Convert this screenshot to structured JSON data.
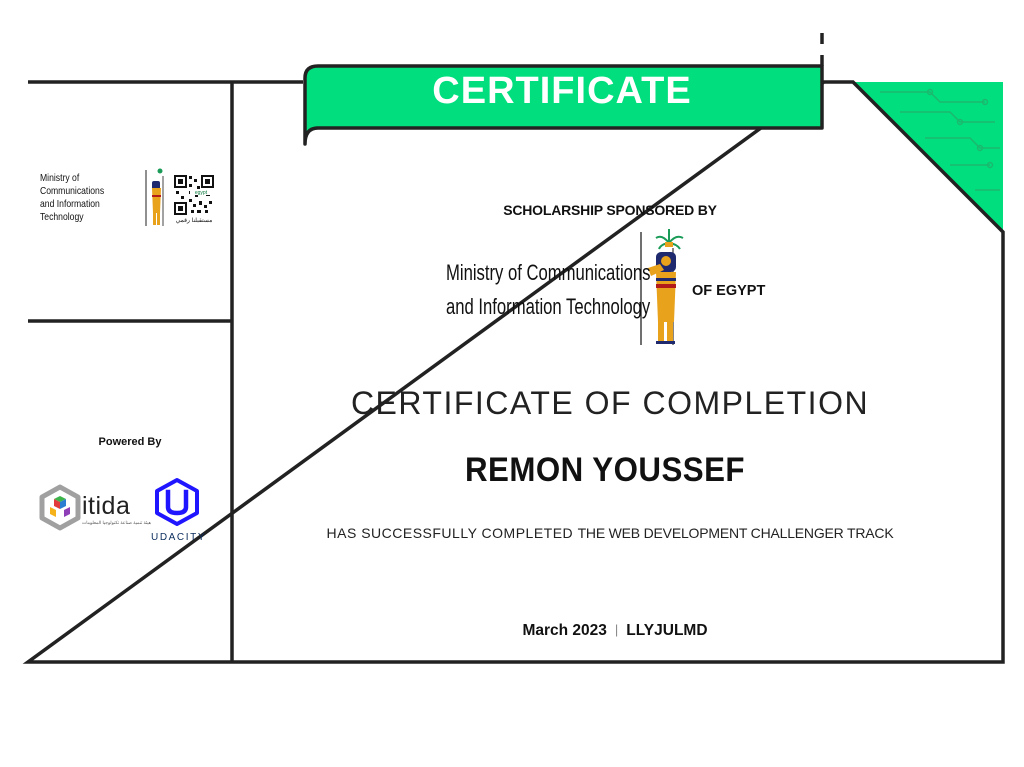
{
  "banner": {
    "title": "CERTIFICATE"
  },
  "left_panel": {
    "ministry_line1": "Ministry of Communications",
    "ministry_line2": "and Information Technology",
    "qr_caption": "مستقبلنا رقمي",
    "powered_by": "Powered By",
    "itida_label": "itida",
    "itida_subtitle": "هيئة تنمية صناعة تكنولوجيا المعلومات",
    "udacity_label": "UDACITY"
  },
  "sponsor": {
    "heading": "SCHOLARSHIP SPONSORED BY",
    "ministry_line1": "Ministry of Communications",
    "ministry_line2": "and Information Technology",
    "country": "OF EGYPT"
  },
  "certificate": {
    "title": "CERTIFICATE OF COMPLETION",
    "recipient": "REMON YOUSSEF",
    "completion_prefix": "HAS SUCCESSFULLY COMPLETED",
    "track": "THE WEB DEVELOPMENT CHALLENGER TRACK",
    "date": "March 2023",
    "separator": "|",
    "code": "LLYJULMD"
  },
  "colors": {
    "accent_green": "#00DE7E",
    "border": "#222222",
    "text": "#111111",
    "egypt_gold": "#E8A21C",
    "udacity_blue": "#2015FF"
  },
  "icons": [
    "egyptian-goddess-emblem",
    "qr-code",
    "itida-cube-logo",
    "udacity-u-logo",
    "circuit-pattern"
  ]
}
